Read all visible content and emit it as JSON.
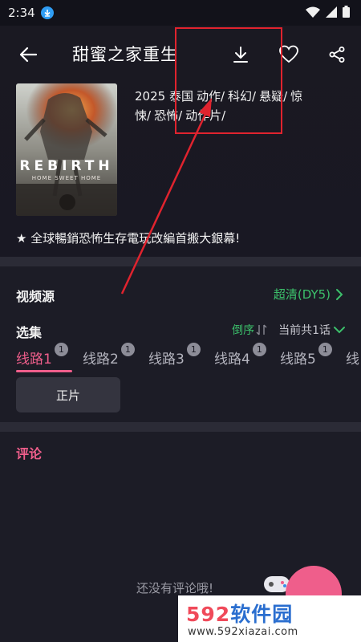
{
  "status_bar": {
    "time": "2:34"
  },
  "header": {
    "title": "甜蜜之家重生"
  },
  "movie": {
    "poster_title": "REBIRTH",
    "poster_subtitle": "HOME SWEET HOME",
    "meta_tags": [
      "2025 泰国",
      "动作/",
      "科幻/",
      "悬疑/",
      "惊",
      "悚/",
      "恐怖/",
      "动作片/"
    ],
    "tagline": "★ 全球暢銷恐怖生存電玩改編首搬大銀幕!"
  },
  "source": {
    "label": "视频源",
    "value": "超清(DY5)"
  },
  "episodes": {
    "label": "选集",
    "order_label": "倒序",
    "count_label": "当前共1话",
    "lines": [
      {
        "label": "线路1",
        "badge": "1"
      },
      {
        "label": "线路2",
        "badge": "1"
      },
      {
        "label": "线路3",
        "badge": "1"
      },
      {
        "label": "线路4",
        "badge": "1"
      },
      {
        "label": "线路5",
        "badge": "1"
      },
      {
        "label": "线",
        "badge": ""
      }
    ],
    "selected_line": 0,
    "episode_button": "正片"
  },
  "comments": {
    "label": "评论",
    "empty_text": "还没有评论哦!"
  },
  "watermark": {
    "brand_num": "592",
    "brand_text": "软件园",
    "url": "www.592xiazai.com"
  },
  "colors": {
    "accent_pink": "#ef5e8b",
    "accent_green": "#3cc06b",
    "annotation_red": "#e0232e"
  }
}
